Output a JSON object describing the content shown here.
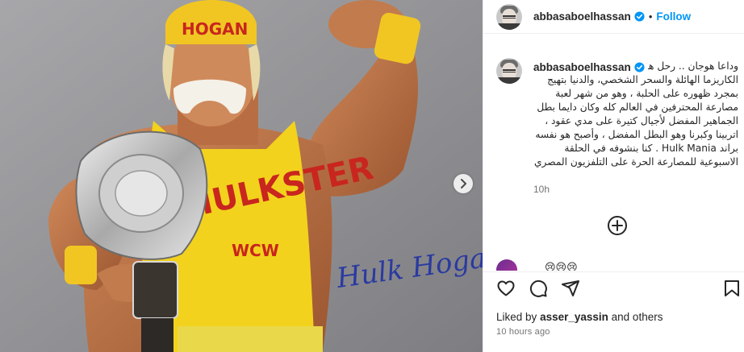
{
  "post": {
    "username": "abbasaboelhassan",
    "follow_label": "Follow",
    "separator": "•",
    "caption": "وداعا هوجان .. رحل هالك هوجان المصارع ذو الكاريزما الهائلة والسحر الشخصي، والدنيا بتهيج بمجرد ظهوره على الحلبة ، وهو من شهر لعبة مصارعة المحترفين في العالم كله وكان دايما بطل الجماهير المفضل لأجيال كتيرة على مدي عقود ، اتربينا وكبرنا وهو البطل المفضل ، وأصبح هو نفسه براند Hulk Mania . كنا بنشوفه في الحلقة الاسبوعية للمصارعة الحرة على التلفزيون المصري",
    "caption_time": "10h",
    "comment_peek": "😢😢😢",
    "liked_by_prefix": "Liked by",
    "liked_by_user": "asser_yassin",
    "liked_by_suffix": "and others",
    "time_ago": "10 hours ago"
  },
  "photo": {
    "bandana_text": "HOGAN",
    "shirt_text": "HULKSTER",
    "wcw_text": "WCW",
    "autograph": "Hulk Hogan"
  },
  "icons": {
    "verified": "verified-badge-icon",
    "next": "chevron-right-icon",
    "load_more": "plus-circle-icon",
    "like": "heart-icon",
    "comment": "comment-icon",
    "share": "paper-plane-icon",
    "save": "bookmark-icon"
  },
  "colors": {
    "accent": "#0095f6",
    "text": "#262626",
    "muted": "#737373",
    "shirt_yellow": "#f2d21c"
  }
}
